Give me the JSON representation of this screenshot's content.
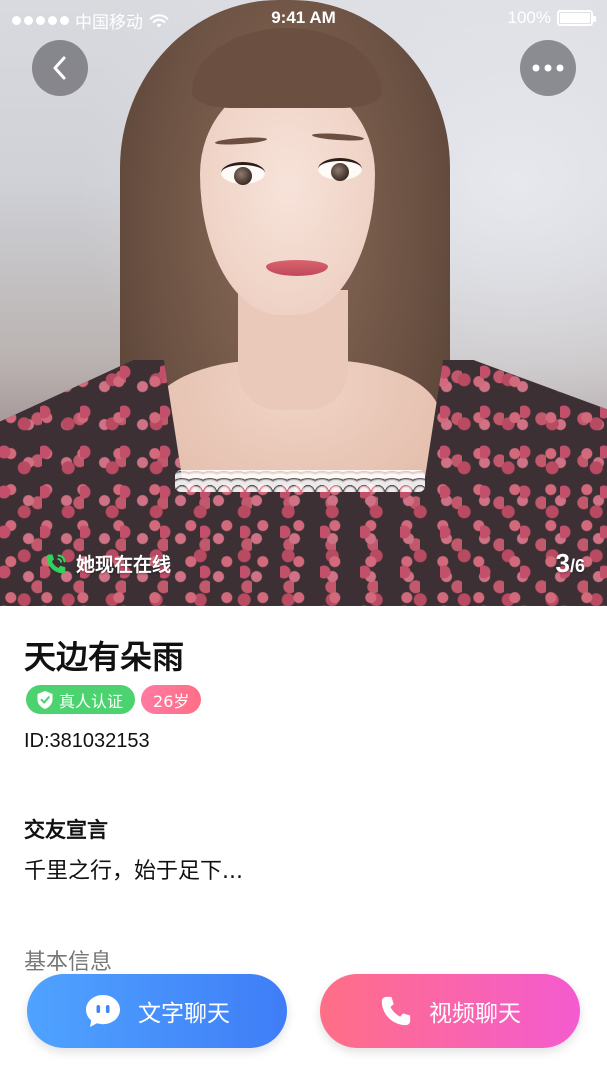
{
  "status_bar": {
    "carrier": "中国移动",
    "time": "9:41 AM",
    "battery": "100%"
  },
  "hero": {
    "online_text": "她现在在线",
    "photo_current": "3",
    "photo_separator": "/",
    "photo_total": "6"
  },
  "profile": {
    "nickname": "天边有朵雨",
    "verified_label": "真人认证",
    "age_label": "26岁",
    "id_text": "ID:381032153"
  },
  "declaration": {
    "title": "交友宣言",
    "text": "千里之行，始于足下..."
  },
  "basic_info": {
    "title": "基本信息"
  },
  "actions": {
    "text_chat": "文字聊天",
    "video_chat": "视频聊天"
  },
  "colors": {
    "verified_green": "#4cd36f",
    "age_pink": "#ff6f86",
    "text_chat_blue": "#3f7df7",
    "video_chat_pink": "#f45bd0",
    "online_icon_green": "#2fd35a"
  }
}
